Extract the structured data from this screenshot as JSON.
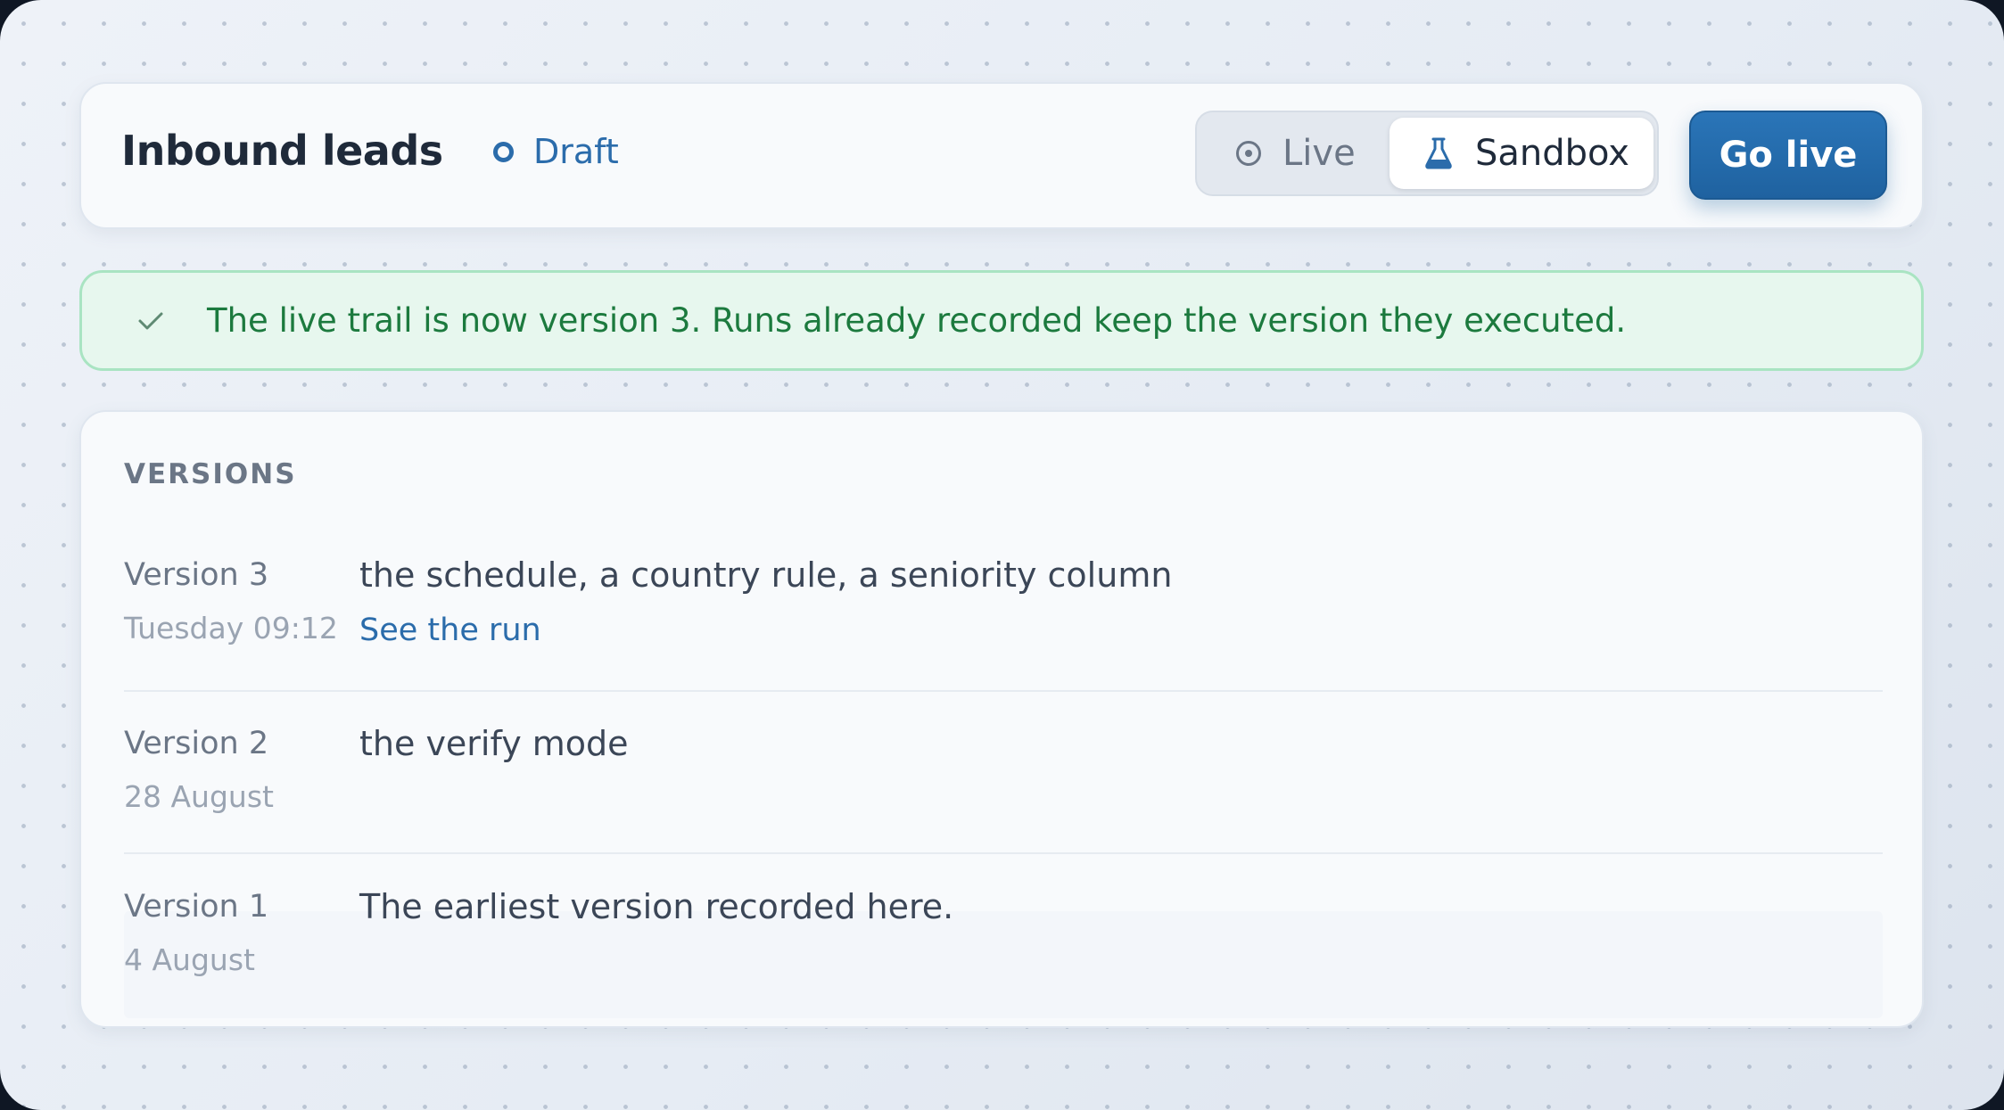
{
  "header": {
    "title": "Inbound leads",
    "status": "Draft",
    "modes": {
      "live_label": "Live",
      "sandbox_label": "Sandbox",
      "selected": "Sandbox"
    },
    "go_live_label": "Go live"
  },
  "banner": {
    "icon": "check-icon",
    "message": "The live trail is now version 3. Runs already recorded keep the version they executed."
  },
  "versions": {
    "heading": "VERSIONS",
    "items": [
      {
        "name": "Version 3",
        "date": "Tuesday 09:12",
        "description": "the schedule, a country rule, a seniority column",
        "link": "See the run"
      },
      {
        "name": "Version 2",
        "date": "28 August",
        "description": "the verify mode"
      },
      {
        "name": "Version 1",
        "date": "4 August",
        "description": "The earliest version recorded here."
      }
    ]
  },
  "colors": {
    "accent": "#2b6cab",
    "success_text": "#1c7a3e",
    "success_bg": "#e7f7ee"
  }
}
